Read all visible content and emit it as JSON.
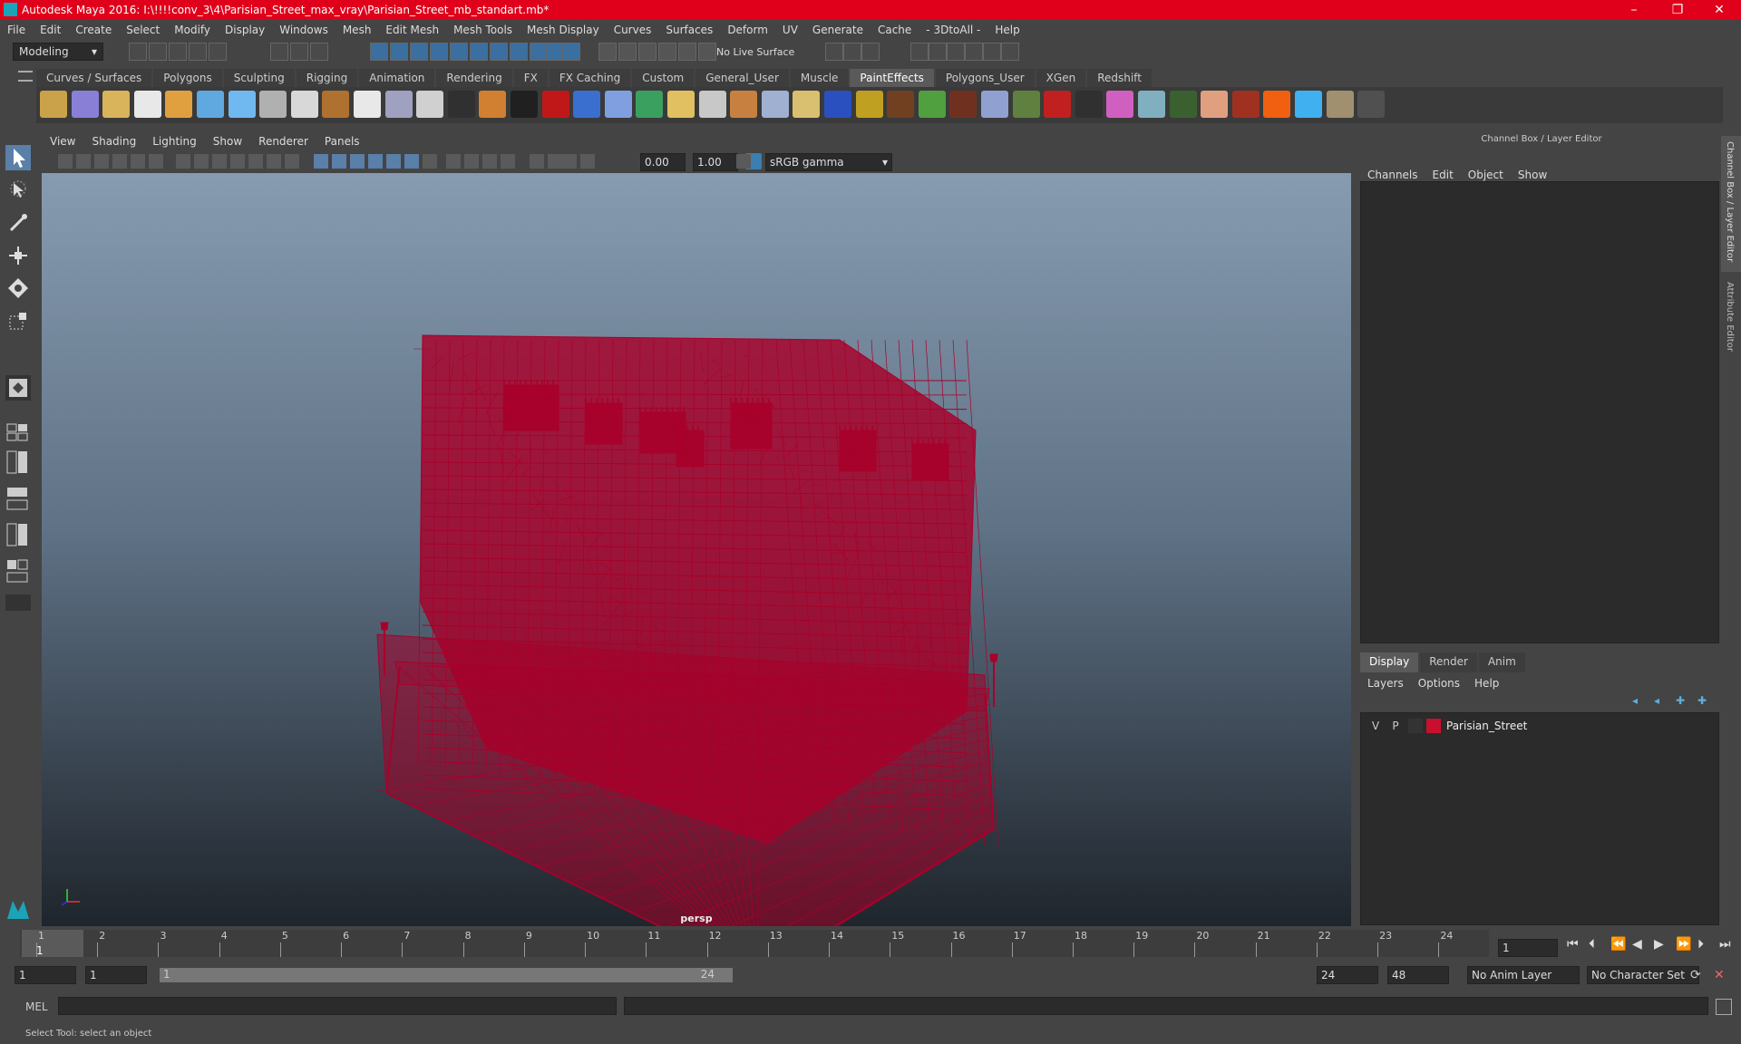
{
  "window": {
    "title": "Autodesk Maya 2016: I:\\!!!!conv_3\\4\\Parisian_Street_max_vray\\Parisian_Street_mb_standart.mb*",
    "controls": [
      "–",
      "❐",
      "✕"
    ]
  },
  "menubar": [
    "File",
    "Edit",
    "Create",
    "Select",
    "Modify",
    "Display",
    "Windows",
    "Mesh",
    "Edit Mesh",
    "Mesh Tools",
    "Mesh Display",
    "Curves",
    "Surfaces",
    "Deform",
    "UV",
    "Generate",
    "Cache",
    "- 3DtoAll -",
    "Help"
  ],
  "toolbar": {
    "mode": "Modeling",
    "live_surface": "No Live Surface"
  },
  "shelf": {
    "tabs": [
      "Curves / Surfaces",
      "Polygons",
      "Sculpting",
      "Rigging",
      "Animation",
      "Rendering",
      "FX",
      "FX Caching",
      "Custom",
      "General_User",
      "Muscle",
      "PaintEffects",
      "Polygons_User",
      "XGen",
      "Redshift"
    ],
    "active_tab": "PaintEffects"
  },
  "viewport": {
    "menu": [
      "View",
      "Shading",
      "Lighting",
      "Show",
      "Renderer",
      "Panels"
    ],
    "exposure": "0.00",
    "gamma": "1.00",
    "color_space": "sRGB gamma",
    "camera_label": "persp",
    "mesh_color": "#a8002a"
  },
  "channel_box": {
    "header": "Channel Box / Layer Editor",
    "menu": [
      "Channels",
      "Edit",
      "Object",
      "Show"
    ],
    "side_tabs": [
      "Channel Box / Layer Editor",
      "Attribute Editor"
    ]
  },
  "layer_editor": {
    "tabs": [
      "Display",
      "Render",
      "Anim"
    ],
    "active_tab": "Display",
    "menu": [
      "Layers",
      "Options",
      "Help"
    ],
    "layers": [
      {
        "v": "V",
        "p": "P",
        "color": "#c8102e",
        "name": "Parisian_Street"
      }
    ]
  },
  "timeline": {
    "ticks": [
      "1",
      "2",
      "3",
      "4",
      "5",
      "6",
      "7",
      "8",
      "9",
      "10",
      "11",
      "12",
      "13",
      "14",
      "15",
      "16",
      "17",
      "18",
      "19",
      "20",
      "21",
      "22",
      "23",
      "24"
    ],
    "current_frame": "1",
    "frame_field": "1"
  },
  "range": {
    "start": "1",
    "playback_start": "1",
    "slider_start": "1",
    "slider_end": "24",
    "playback_end": "24",
    "end": "48",
    "anim_layer": "No Anim Layer",
    "character_set": "No Character Set"
  },
  "command_line": {
    "language": "MEL"
  },
  "status": "Select Tool: select an object"
}
